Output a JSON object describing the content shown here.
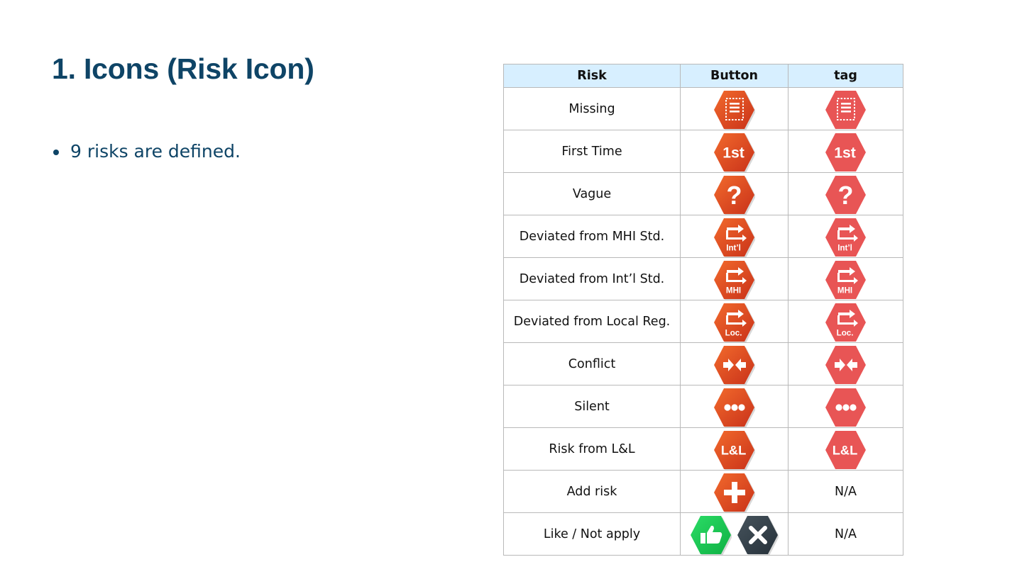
{
  "slide": {
    "title": "1. Icons (Risk Icon)",
    "bullets": [
      "9 risks are defined."
    ]
  },
  "table": {
    "headers": [
      "Risk",
      "Button",
      "tag"
    ],
    "rows": [
      {
        "risk": "Missing",
        "icon": "missing-document-icon",
        "tag": "icon"
      },
      {
        "risk": "First Time",
        "icon": "first-time-icon",
        "tag": "icon"
      },
      {
        "risk": "Vague",
        "icon": "question-mark-icon",
        "tag": "icon"
      },
      {
        "risk": "Deviated from MHI Std.",
        "icon": "deviation-intl-icon",
        "tag": "icon"
      },
      {
        "risk": "Deviated from Int’l Std.",
        "icon": "deviation-mhi-icon",
        "tag": "icon"
      },
      {
        "risk": "Deviated from Local Reg.",
        "icon": "deviation-local-icon",
        "tag": "icon"
      },
      {
        "risk": "Conflict",
        "icon": "conflict-arrows-icon",
        "tag": "icon"
      },
      {
        "risk": "Silent",
        "icon": "ellipsis-icon",
        "tag": "icon"
      },
      {
        "risk": "Risk from L&L",
        "icon": "lessons-learned-icon",
        "tag": "icon"
      },
      {
        "risk": "Add risk",
        "icon": "add-plus-icon",
        "tag": "N/A"
      },
      {
        "risk": "Like / Not apply",
        "icon": "thumbs-up-icon + close-x-icon",
        "tag": "N/A"
      }
    ],
    "icon_text": {
      "first": "1st",
      "intl": "Int’l",
      "mhi": "MHI",
      "loc": "Loc.",
      "ll": "L&L"
    }
  },
  "colors": {
    "title": "#0e4466",
    "header_bg": "#d7efff",
    "button_orange": "#e8501f",
    "tag_red": "#e85555",
    "like_green": "#19c951",
    "notapply_dark": "#344049"
  }
}
